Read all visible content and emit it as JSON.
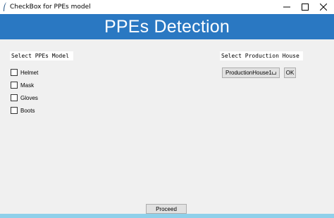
{
  "window": {
    "title": "CheckBox for PPEs model",
    "controls": {
      "minimize_icon": "minimize-icon",
      "maximize_icon": "maximize-icon",
      "close_icon": "close-icon"
    }
  },
  "banner": {
    "title": "PPEs Detection",
    "background": "#2a78c2",
    "text_color": "#ffffff"
  },
  "model_section": {
    "label": "Select PPEs Model",
    "checkboxes": [
      {
        "label": "Helmet",
        "checked": false
      },
      {
        "label": "Mask",
        "checked": false
      },
      {
        "label": "Gloves",
        "checked": false
      },
      {
        "label": "Boots",
        "checked": false
      }
    ]
  },
  "house_section": {
    "label": "Select Production House",
    "dropdown_value": "ProductionHouse1",
    "ok_label": "OK"
  },
  "footer": {
    "proceed_label": "Proceed"
  }
}
